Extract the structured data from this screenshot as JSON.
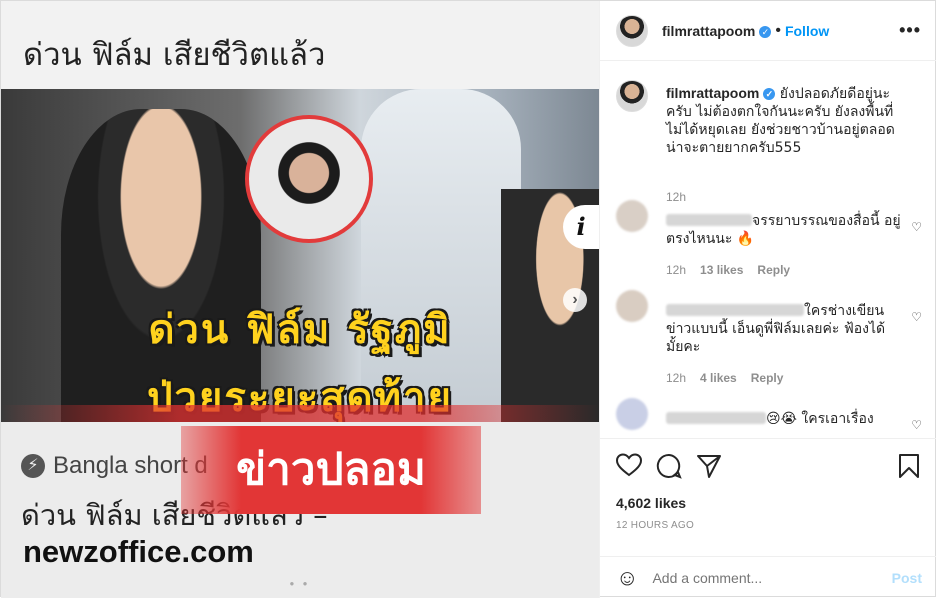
{
  "media": {
    "top_title": "ด่วน ฟิล์ม เสียชีวิตแล้ว",
    "headline_1": "ด่วน ฟิล์ม รัฐภูมิ",
    "headline_2": "ป่วยระยะสุดท้าย",
    "fake_label": "ข่าวปลอม",
    "link_source": "Bangla short d",
    "link_title": "ด่วน ฟิล์ม เสียชีวิตแล้ว –",
    "link_domain": "newzoffice.com",
    "info_glyph": "i",
    "next_glyph": "›"
  },
  "header": {
    "username": "filmrattapoom",
    "separator": "•",
    "follow_label": "Follow",
    "more_glyph": "•••"
  },
  "caption": {
    "username": "filmrattapoom",
    "text": "ยังปลอดภัยดีอยู่นะครับ ไม่ต้องตกใจกันนะครับ ยังลงพื้นที่ไม่ได้หยุดเลย ยังช่วยชาวบ้านอยู่ตลอดน่าจะตายยากครับ555",
    "time": "12h"
  },
  "comments": [
    {
      "text": "จรรยาบรรณของสื่อนี้ อยู่ตรงไหนนะ 🔥",
      "time": "12h",
      "likes": "13 likes",
      "reply": "Reply"
    },
    {
      "text": "ใครช่างเขียนข่าวแบบนี้ เอ็นดูพี่ฟิล์มเลยค่ะ ฟ้องได้มั้ยคะ",
      "time": "12h",
      "likes": "4 likes",
      "reply": "Reply"
    },
    {
      "text": "😢😭 ใครเอาเรื่อง",
      "time": "",
      "likes": "",
      "reply": ""
    }
  ],
  "actions": {
    "likes": "4,602 likes",
    "ago": "12 HOURS AGO",
    "comment_placeholder": "Add a comment...",
    "post_label": "Post"
  },
  "colors": {
    "accent": "#0095f6",
    "post_disabled": "#b2dffc",
    "fake_red": "#e23636",
    "headline_yellow": "#ffd21e"
  }
}
